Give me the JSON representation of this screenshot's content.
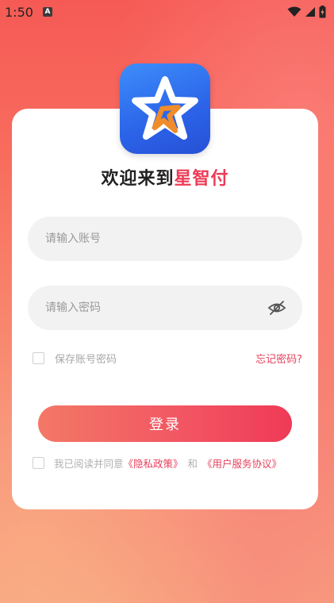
{
  "status_bar": {
    "time": "1:50",
    "notification_glyph": "A",
    "icons": [
      "wifi-icon",
      "signal-icon",
      "battery-icon"
    ]
  },
  "login": {
    "welcome_prefix": "欢迎来到",
    "brand_name": "星智付",
    "account_placeholder": "请输入账号",
    "password_placeholder": "请输入密码",
    "remember_label": "保存账号密码",
    "forgot_label": "忘记密码?",
    "login_button": "登录",
    "agree_text": "我已阅读并同意",
    "privacy_link": "《隐私政策》",
    "and_text": "和",
    "terms_link": "《用户服务协议》"
  },
  "colors": {
    "brand": "#ee3b57",
    "logo_blue": "#2b63e8",
    "logo_star_orange": "#f08c2a"
  }
}
